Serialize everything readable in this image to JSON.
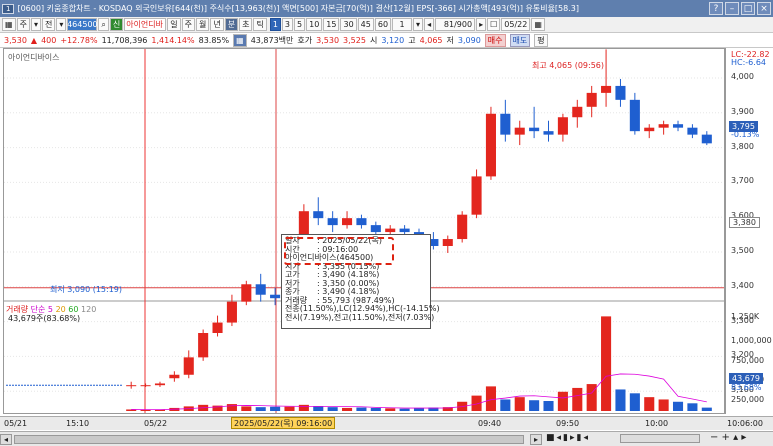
{
  "window": {
    "number": "1",
    "title": "[0600] 키움종합차트 - KOSDAQ 외국인보유[644(천)] 주식수[13,963(천)] 액면[500] 자본금[70(억)] 결산[12월] EPS[-366] 시가총액[493(억)] 유통비율[58.3]"
  },
  "toolbar": {
    "type_select": "주",
    "scope_select": "전",
    "code": "464500",
    "credit_badge": "신",
    "stock_name": "아이언디바",
    "periods": [
      "일",
      "주",
      "월",
      "년",
      "분",
      "초",
      "틱"
    ],
    "selected_period": "분",
    "intervals": [
      "1",
      "3",
      "5",
      "10",
      "15",
      "30",
      "45",
      "60"
    ],
    "selected_interval": "1",
    "interval_value": "1",
    "count": "81",
    "count_max": "900",
    "date": "05/22"
  },
  "quote": {
    "price": "3,530",
    "change_arrow": "▲",
    "change": "400",
    "change_pct": "+12.78%",
    "volume": "11,708,396",
    "turnover_amount": "1,414.14%",
    "ratio": "83.85%",
    "trade_value": "43,873백만",
    "ask_label": "호가",
    "ask": "3,530",
    "bid": "3,525",
    "open_label": "시",
    "open": "3,120",
    "high_label": "고",
    "high": "4,065",
    "low_label": "저",
    "low": "3,090",
    "buy_button": "매수",
    "sell_button": "매도",
    "balance_button": "평"
  },
  "chart": {
    "legend": "아이언디바이스",
    "high_annotation": "최고 4,065 (09:56)",
    "low_annotation": "최저 3,090 (15:19)",
    "lc_label": "LC:-22.82",
    "hc_label": "HC:-6.64",
    "price_ticks": [
      "4,000",
      "3,900",
      "3,800",
      "3,700",
      "3,600",
      "3,500",
      "3,400",
      "3,300",
      "3,200",
      "3,100"
    ],
    "current_tag": "3,795",
    "current_pct": "-0.13%",
    "cursor_tag": "3,380",
    "volume_legend": {
      "label": "거래량",
      "ma": "단순",
      "p1": "5",
      "p2": "20",
      "p3": "60",
      "p4": "120"
    },
    "volume_info": "43,679주(83.68%)",
    "volume_ticks": [
      "1,250K",
      "1,000,000",
      "750,000",
      "500,000",
      "250,000"
    ],
    "volume_tag": "43,679",
    "volume_tag_pct": "83.68%",
    "time_labels": [
      "05/21",
      "15:10",
      "05/22",
      "09:30",
      "09:40",
      "09:50",
      "10:00"
    ],
    "cursor_time": "2025/05/22(목) 09:16:00",
    "axis_time": "10:06:00"
  },
  "tooltip": {
    "rows": [
      {
        "k": "일자",
        "v": ": 2025/05/22(목)"
      },
      {
        "k": "시간",
        "v": ": 09:16:00"
      },
      {
        "k": "",
        "v": "아이언디바이스(464500)"
      },
      {
        "k": "시가",
        "v": ": 3,355 (0.15%)"
      },
      {
        "k": "고가",
        "v": ": 3,490 (4.18%)"
      },
      {
        "k": "저가",
        "v": ": 3,350 (0.00%)"
      },
      {
        "k": "종가",
        "v": ": 3,490 (4.18%)"
      },
      {
        "k": "거래량",
        "v": ": 55,793 (987.49%)"
      },
      {
        "k": "",
        "v": "전종(11.50%),LC(12.94%),HC(-14.15%)"
      },
      {
        "k": "",
        "v": "전시(7.19%),전고(11.50%),전저(7.03%)"
      }
    ]
  },
  "chart_data": {
    "type": "candlestick",
    "series": [
      {
        "name": "price",
        "ohlc": [
          [
            3100,
            3110,
            3090,
            3100
          ],
          [
            3100,
            3105,
            3095,
            3100
          ],
          [
            3100,
            3110,
            3095,
            3105
          ],
          [
            3120,
            3140,
            3110,
            3130
          ],
          [
            3130,
            3200,
            3120,
            3180
          ],
          [
            3180,
            3260,
            3170,
            3250
          ],
          [
            3250,
            3300,
            3240,
            3280
          ],
          [
            3280,
            3360,
            3270,
            3340
          ],
          [
            3340,
            3400,
            3330,
            3390
          ],
          [
            3390,
            3420,
            3340,
            3360
          ],
          [
            3360,
            3380,
            3330,
            3350
          ],
          [
            3355,
            3490,
            3350,
            3490
          ],
          [
            3490,
            3620,
            3470,
            3600
          ],
          [
            3600,
            3640,
            3560,
            3580
          ],
          [
            3580,
            3600,
            3540,
            3560
          ],
          [
            3560,
            3600,
            3550,
            3580
          ],
          [
            3580,
            3590,
            3550,
            3560
          ],
          [
            3560,
            3570,
            3530,
            3540
          ],
          [
            3540,
            3560,
            3520,
            3550
          ],
          [
            3550,
            3560,
            3530,
            3540
          ],
          [
            3540,
            3550,
            3510,
            3520
          ],
          [
            3520,
            3540,
            3490,
            3500
          ],
          [
            3500,
            3530,
            3480,
            3520
          ],
          [
            3520,
            3600,
            3510,
            3590
          ],
          [
            3590,
            3720,
            3580,
            3700
          ],
          [
            3700,
            3900,
            3690,
            3880
          ],
          [
            3880,
            3920,
            3800,
            3820
          ],
          [
            3820,
            3860,
            3790,
            3840
          ],
          [
            3840,
            3900,
            3810,
            3830
          ],
          [
            3830,
            3860,
            3800,
            3820
          ],
          [
            3820,
            3880,
            3800,
            3870
          ],
          [
            3870,
            3920,
            3840,
            3900
          ],
          [
            3900,
            3960,
            3870,
            3940
          ],
          [
            3940,
            4065,
            3900,
            3960
          ],
          [
            3960,
            3980,
            3900,
            3920
          ],
          [
            3920,
            3940,
            3820,
            3830
          ],
          [
            3830,
            3850,
            3810,
            3840
          ],
          [
            3840,
            3860,
            3820,
            3850
          ],
          [
            3850,
            3860,
            3830,
            3840
          ],
          [
            3840,
            3850,
            3810,
            3820
          ],
          [
            3820,
            3830,
            3790,
            3795
          ]
        ]
      },
      {
        "name": "volume",
        "values": [
          20,
          15,
          18,
          40,
          60,
          80,
          70,
          90,
          60,
          50,
          55,
          56,
          80,
          60,
          50,
          40,
          45,
          40,
          35,
          30,
          40,
          45,
          50,
          120,
          200,
          320,
          150,
          180,
          140,
          130,
          250,
          300,
          350,
          1230,
          280,
          230,
          180,
          150,
          120,
          100,
          44
        ]
      }
    ]
  }
}
